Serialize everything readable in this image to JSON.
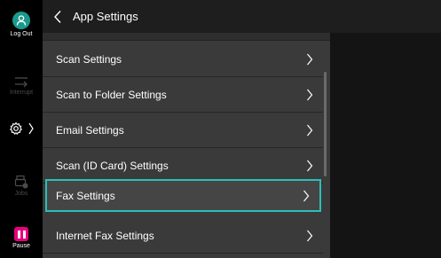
{
  "header": {
    "title": "App Settings"
  },
  "rail": {
    "logout_label": "Log Out",
    "interrupt_label": "Interrupt",
    "jobs_label": "Jobs",
    "pause_label": "Pause"
  },
  "list": {
    "items": [
      {
        "label": "Scan Settings"
      },
      {
        "label": "Scan to Folder Settings"
      },
      {
        "label": "Email Settings"
      },
      {
        "label": "Scan (ID Card) Settings"
      },
      {
        "label": "Fax Settings",
        "selected": true
      },
      {
        "label": "Internet Fax Settings"
      }
    ]
  },
  "colors": {
    "accent": "#2bbfb6",
    "logout": "#1a9a8c",
    "pause": "#e6007e"
  }
}
